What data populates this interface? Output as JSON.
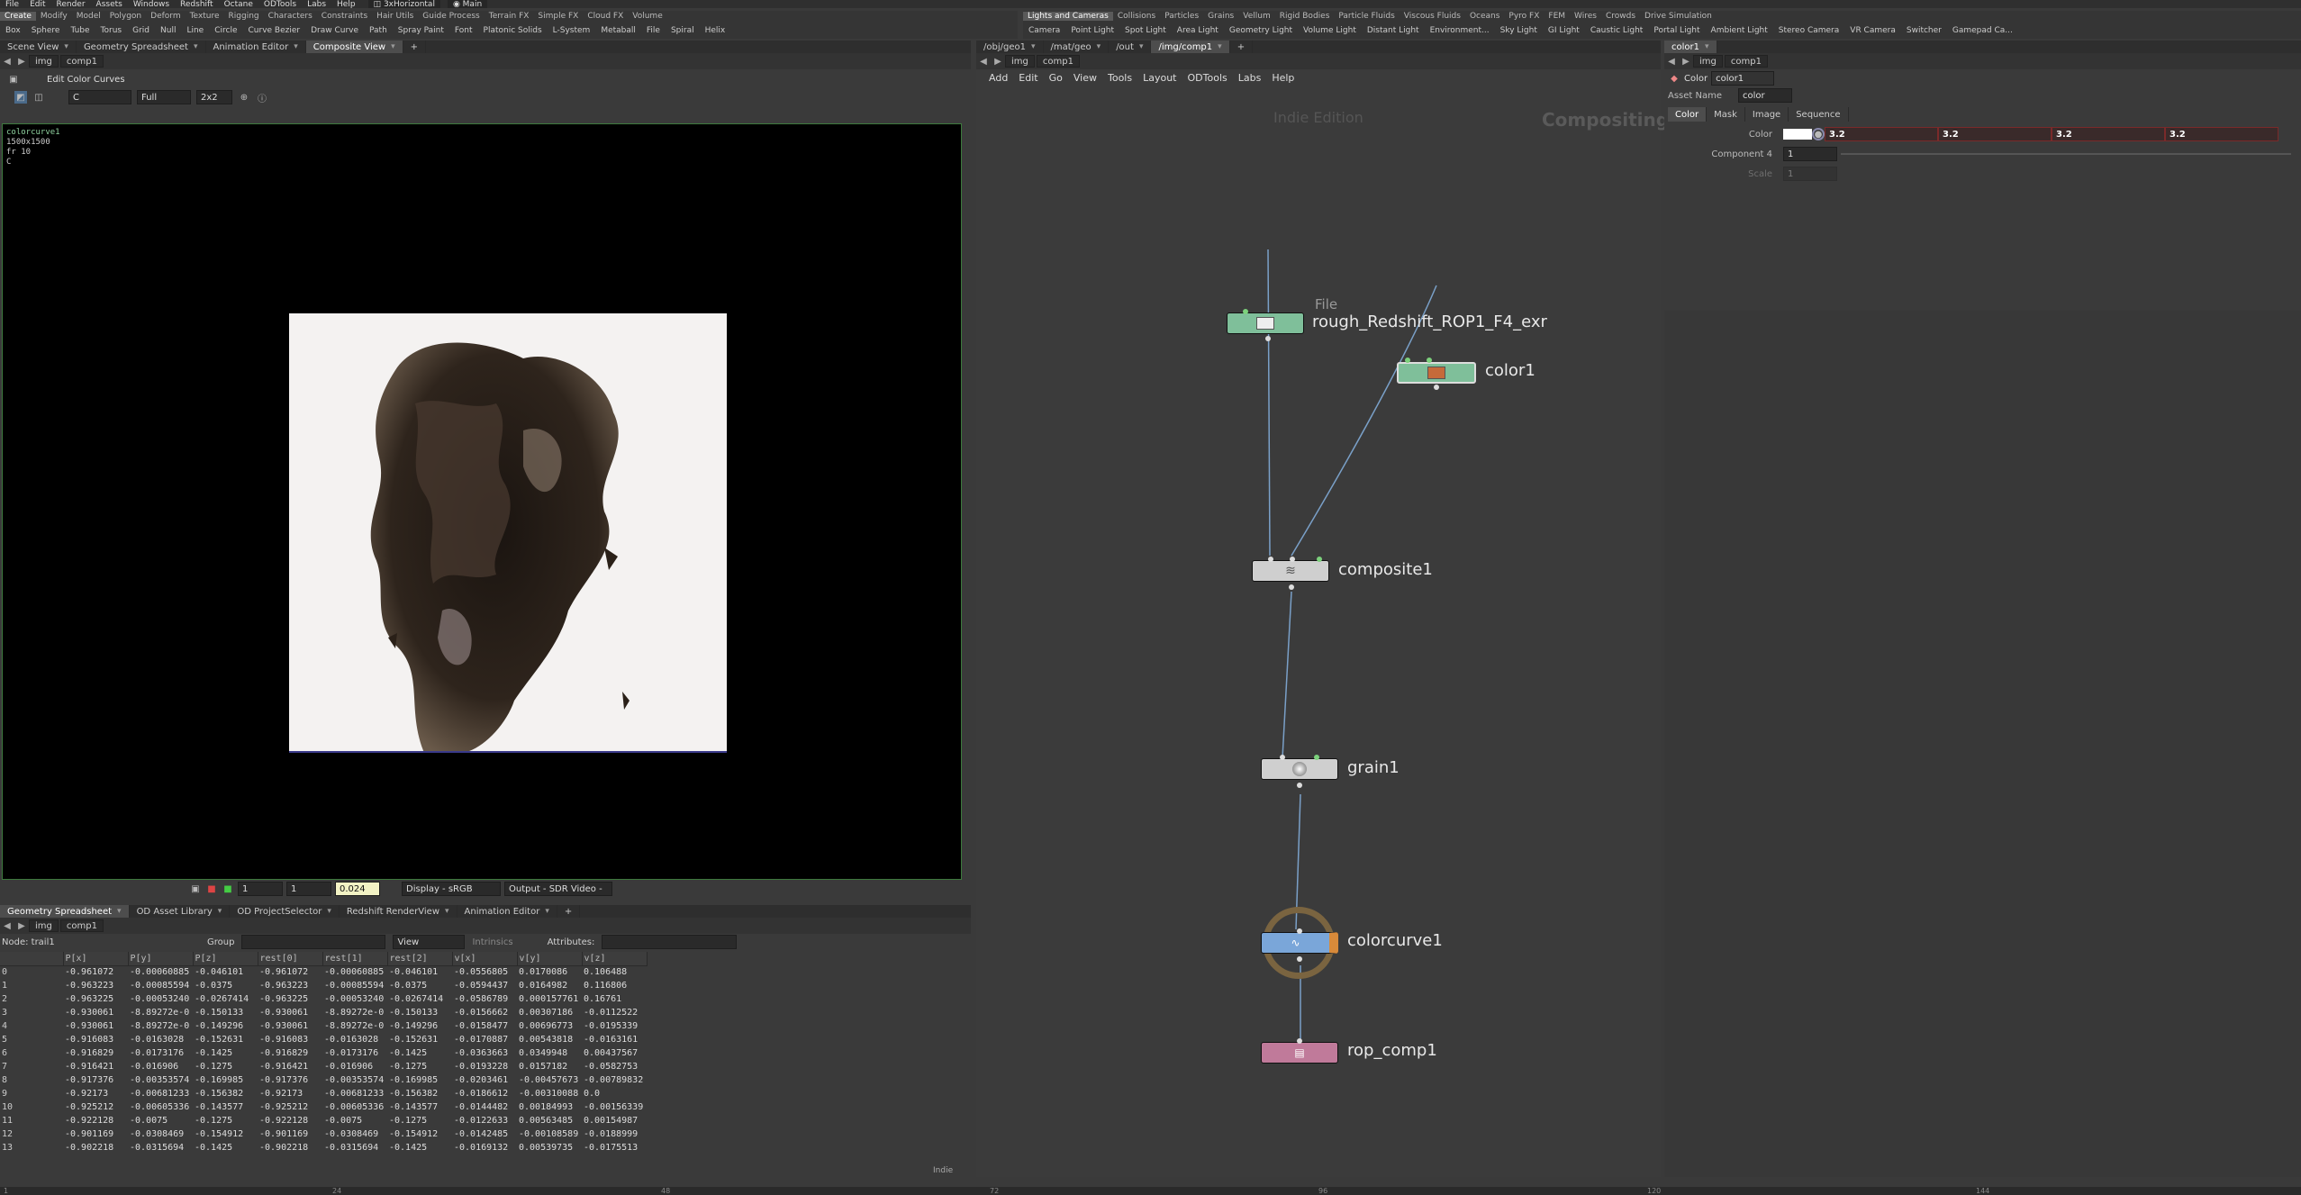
{
  "main_menu": [
    "File",
    "Edit",
    "Render",
    "Assets",
    "Windows",
    "Redshift",
    "Octane",
    "ODTools",
    "Labs",
    "Help"
  ],
  "desktop": {
    "layout": "3xHorizontal",
    "name": "Main"
  },
  "shelf_left": {
    "tabs": [
      "Create",
      "Modify",
      "Model",
      "Polygon",
      "Deform",
      "Texture",
      "Rigging",
      "Characters",
      "Constraints",
      "Hair Utils",
      "Guide Process",
      "Terrain FX",
      "Simple FX",
      "Cloud FX",
      "Volume"
    ],
    "tools": [
      "Box",
      "Sphere",
      "Tube",
      "Torus",
      "Grid",
      "Null",
      "Line",
      "Circle",
      "Curve Bezier",
      "Draw Curve",
      "Path",
      "Spray Paint",
      "Font",
      "Platonic Solids",
      "L-System",
      "Metaball",
      "File",
      "Spiral",
      "Helix"
    ]
  },
  "shelf_right": {
    "tabs": [
      "Lights and Cameras",
      "Collisions",
      "Particles",
      "Grains",
      "Vellum",
      "Rigid Bodies",
      "Particle Fluids",
      "Viscous Fluids",
      "Oceans",
      "Pyro FX",
      "FEM",
      "Wires",
      "Crowds",
      "Drive Simulation"
    ],
    "tools": [
      "Camera",
      "Point Light",
      "Spot Light",
      "Area Light",
      "Geometry Light",
      "Volume Light",
      "Distant Light",
      "Environment...",
      "Sky Light",
      "GI Light",
      "Caustic Light",
      "Portal Light",
      "Ambient Light",
      "Stereo Camera",
      "VR Camera",
      "Switcher",
      "Gamepad Ca..."
    ]
  },
  "viewer": {
    "tabs": [
      "Scene View",
      "Geometry Spreadsheet",
      "Animation Editor",
      "Composite View"
    ],
    "path": [
      "img",
      "comp1"
    ],
    "op_label": "Edit Color Curves",
    "plane": "C",
    "res": "Full",
    "grid": "2x2",
    "overlay": [
      "colorcurve1",
      "1500x1500",
      "fr 10",
      "C"
    ],
    "frame_a": "1",
    "frame_b": "1",
    "value": "0.024",
    "display": "Display - sRGB",
    "output": "Output - SDR Video -"
  },
  "spreadsheet": {
    "tabs": [
      "Geometry Spreadsheet",
      "OD Asset Library",
      "OD ProjectSelector",
      "Redshift RenderView",
      "Animation Editor"
    ],
    "path": [
      "img",
      "comp1"
    ],
    "node_label": "Node: trail1",
    "group_label": "Group",
    "view_label": "View",
    "intrinsics_label": "Intrinsics",
    "attributes_label": "Attributes:",
    "columns": [
      "",
      "P[x]",
      "P[y]",
      "P[z]",
      "rest[0]",
      "rest[1]",
      "rest[2]",
      "v[x]",
      "v[y]",
      "v[z]"
    ],
    "rows": [
      [
        "0",
        "-0.961072",
        "-0.00060885",
        "-0.046101",
        "-0.961072",
        "-0.00060885",
        "-0.046101",
        "-0.0556805",
        "0.0170086",
        "0.106488"
      ],
      [
        "1",
        "-0.963223",
        "-0.00085594",
        "-0.0375",
        "-0.963223",
        "-0.00085594",
        "-0.0375",
        "-0.0594437",
        "0.0164982",
        "0.116806"
      ],
      [
        "2",
        "-0.963225",
        "-0.00053240",
        "-0.0267414",
        "-0.963225",
        "-0.00053240",
        "-0.0267414",
        "-0.0586789",
        "0.000157761",
        "0.16761"
      ],
      [
        "3",
        "-0.930061",
        "-8.89272e-0",
        "-0.150133",
        "-0.930061",
        "-8.89272e-0",
        "-0.150133",
        "-0.0156662",
        "0.00307186",
        "-0.0112522"
      ],
      [
        "4",
        "-0.930061",
        "-8.89272e-0",
        "-0.149296",
        "-0.930061",
        "-8.89272e-0",
        "-0.149296",
        "-0.0158477",
        "0.00696773",
        "-0.0195339"
      ],
      [
        "5",
        "-0.916083",
        "-0.0163028",
        "-0.152631",
        "-0.916083",
        "-0.0163028",
        "-0.152631",
        "-0.0170887",
        "0.00543818",
        "-0.0163161"
      ],
      [
        "6",
        "-0.916829",
        "-0.0173176",
        "-0.1425",
        "-0.916829",
        "-0.0173176",
        "-0.1425",
        "-0.0363663",
        "0.0349948",
        "0.00437567"
      ],
      [
        "7",
        "-0.916421",
        "-0.016906",
        "-0.1275",
        "-0.916421",
        "-0.016906",
        "-0.1275",
        "-0.0193228",
        "0.0157182",
        "-0.0582753"
      ],
      [
        "8",
        "-0.917376",
        "-0.00353574",
        "-0.169985",
        "-0.917376",
        "-0.00353574",
        "-0.169985",
        "-0.0203461",
        "-0.00457673",
        "-0.00789832"
      ],
      [
        "9",
        "-0.92173",
        "-0.00681233",
        "-0.156382",
        "-0.92173",
        "-0.00681233",
        "-0.156382",
        "-0.0186612",
        "-0.00310088",
        "0.0"
      ],
      [
        "10",
        "-0.925212",
        "-0.00605336",
        "-0.143577",
        "-0.925212",
        "-0.00605336",
        "-0.143577",
        "-0.0144482",
        "0.00184993",
        "-0.00156339"
      ],
      [
        "11",
        "-0.922128",
        "-0.0075",
        "-0.1275",
        "-0.922128",
        "-0.0075",
        "-0.1275",
        "-0.0122633",
        "0.00563485",
        "0.00154987"
      ],
      [
        "12",
        "-0.901169",
        "-0.0308469",
        "-0.154912",
        "-0.901169",
        "-0.0308469",
        "-0.154912",
        "-0.0142485",
        "-0.00108589",
        "-0.0188999"
      ],
      [
        "13",
        "-0.902218",
        "-0.0315694",
        "-0.1425",
        "-0.902218",
        "-0.0315694",
        "-0.1425",
        "-0.0169132",
        "0.00539735",
        "-0.0175513"
      ]
    ],
    "status": "Indie"
  },
  "network": {
    "path_tabs": [
      "/obj/geo1",
      "/mat/geo",
      "/out",
      "/img/comp1"
    ],
    "path": [
      "img",
      "comp1"
    ],
    "menu": [
      "Add",
      "Edit",
      "Go",
      "View",
      "Tools",
      "Layout",
      "ODTools",
      "Labs",
      "Help"
    ],
    "watermark": "Indie Edition",
    "context": "Compositing",
    "file_type_label": "File",
    "nodes": {
      "file": "rough_Redshift_ROP1_F4_exr",
      "color": "color1",
      "composite": "composite1",
      "grain": "grain1",
      "colorcurve": "colorcurve1",
      "rop": "rop_comp1"
    }
  },
  "params": {
    "tab": "color1",
    "path": [
      "img",
      "comp1"
    ],
    "type_label": "Color",
    "node_name": "color1",
    "asset_name_label": "Asset Name",
    "asset_name": "color",
    "tabs": [
      "Color",
      "Mask",
      "Image",
      "Sequence"
    ],
    "color_label": "Color",
    "color_values": [
      "3.2",
      "3.2",
      "3.2",
      "3.2"
    ],
    "comp4_label": "Component 4",
    "comp4_value": "1",
    "scale_label": "Scale",
    "scale_value": "1"
  },
  "timeline": [
    "1",
    "24",
    "48",
    "72",
    "96",
    "120",
    "144"
  ],
  "colors": {
    "accent": "#a5c8e8",
    "file_node": "#7fbf9a",
    "color_node": "#7fbf9a",
    "rop_node": "#c07a9a",
    "colorcurve_node": "#7aa6d9",
    "error_red": "#8a2c2c"
  }
}
